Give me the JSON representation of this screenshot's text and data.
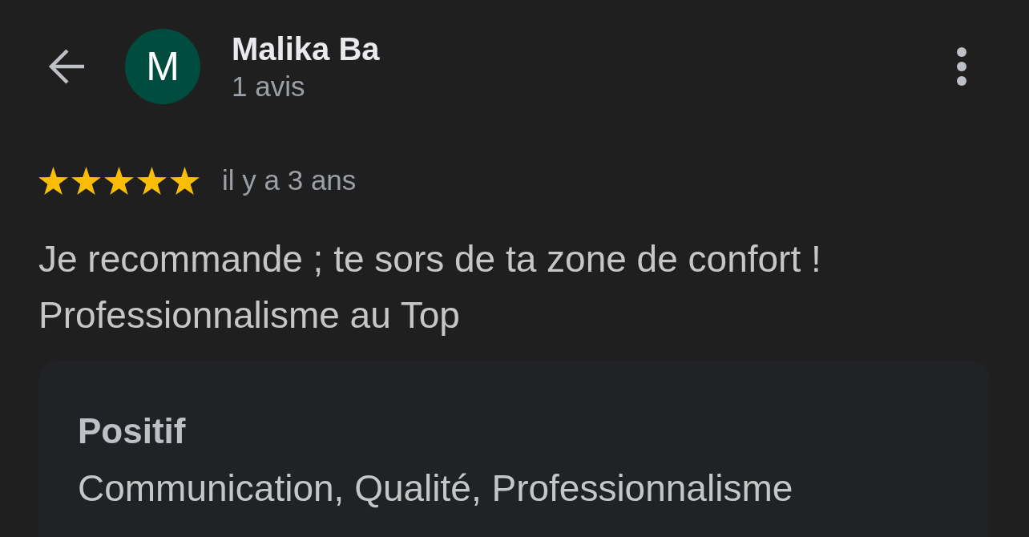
{
  "header": {
    "avatar_letter": "M",
    "name": "Malika Ba",
    "review_count": "1 avis"
  },
  "review": {
    "stars": 5,
    "time": "il y a 3 ans",
    "text": "Je recommande ; te sors de ta zone de confort !\nProfessionnalisme au Top"
  },
  "highlights": {
    "title": "Positif",
    "text": "Communication, Qualité, Professionnalisme"
  }
}
